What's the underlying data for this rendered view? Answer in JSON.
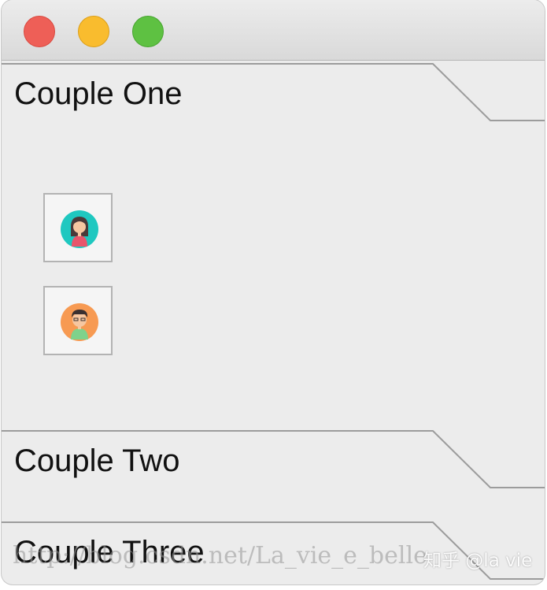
{
  "window": {
    "buttons": [
      "close",
      "minimize",
      "zoom"
    ],
    "button_colors": {
      "close": "#ee5f57",
      "minimize": "#f9bc2e",
      "zoom": "#5ec142"
    }
  },
  "panes": [
    {
      "title": "Couple One",
      "expanded": true,
      "items": [
        {
          "icon": "woman-avatar-icon",
          "bg_color": "#1fc8c0"
        },
        {
          "icon": "man-avatar-icon",
          "bg_color": "#f79a52"
        }
      ]
    },
    {
      "title": "Couple Two",
      "expanded": false
    },
    {
      "title": "Couple Three",
      "expanded": false
    }
  ],
  "watermark": {
    "url_text": "http://blog.csdn.net/La_vie_e_belle",
    "site_text": "知乎 @la vie"
  }
}
